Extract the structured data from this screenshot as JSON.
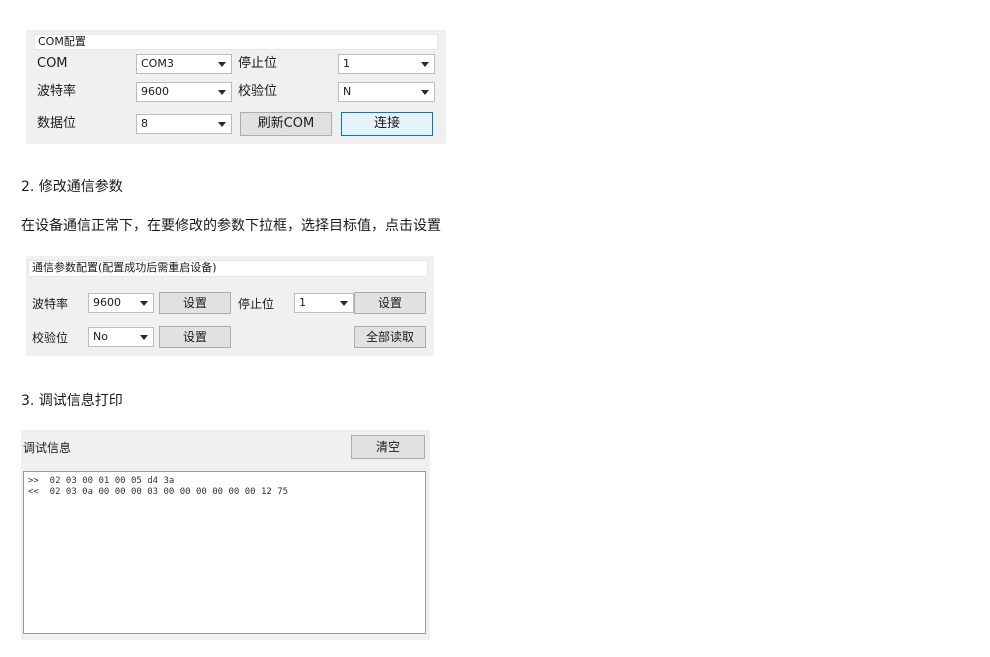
{
  "com_panel": {
    "title": "COM配置",
    "com_label": "COM",
    "com_value": "COM3",
    "stop_label": "停止位",
    "stop_value": "1",
    "baud_label": "波特率",
    "baud_value": "9600",
    "parity_label": "校验位",
    "parity_value": "N",
    "data_label": "数据位",
    "data_value": "8",
    "refresh_label": "刷新COM",
    "connect_label": "连接"
  },
  "section2": {
    "heading": "2. 修改通信参数",
    "desc": "在设备通信正常下，在要修改的参数下拉框，选择目标值，点击设置"
  },
  "param_panel": {
    "title": "通信参数配置(配置成功后需重启设备)",
    "baud_label": "波特率",
    "baud_value": "9600",
    "set_label": "设置",
    "stop_label": "停止位",
    "stop_value": "1",
    "parity_label": "校验位",
    "parity_value": "No",
    "read_all_label": "全部读取"
  },
  "section3": {
    "heading": "3. 调试信息打印"
  },
  "debug_panel": {
    "title": "调试信息",
    "clear_label": "清空",
    "lines": [
      ">>  02 03 00 01 00 05 d4 3a",
      "<<  02 03 0a 00 00 00 03 00 00 00 00 00 00 12 75"
    ]
  }
}
